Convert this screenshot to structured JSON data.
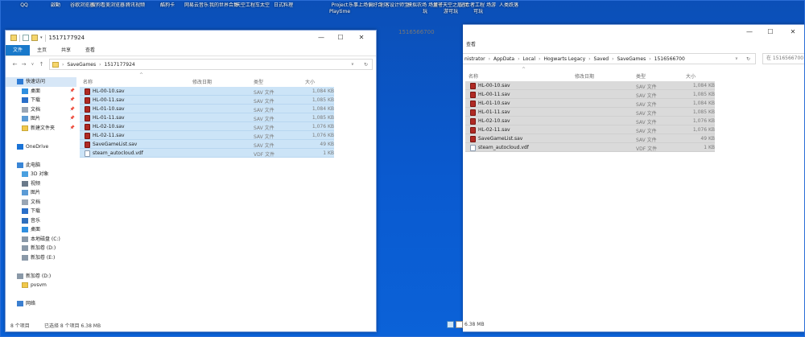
{
  "desktop": {
    "icons": [
      "QQ",
      "啟動",
      "谷歌浏览器",
      "搜狗看美浏览器",
      "腾讯视频",
      "酷狗卡",
      "网易云音乐",
      "我的世界合集",
      "天空工程车太空",
      "日式料理",
      "Project Playtime",
      "乐事上场偏好合",
      "创客设计师宝",
      "模拟农场 场游可玩",
      "量子天空之盾 场游可玩",
      "逃亡者工程 场游可玩",
      "人类跌落"
    ]
  },
  "window1": {
    "title": "1517177924",
    "ribbon_tabs": [
      "文件",
      "主页",
      "共享",
      "查看"
    ],
    "address": [
      "SaveGames",
      "1517177924"
    ],
    "nav_items": [
      {
        "label": "快速访问",
        "icon": "star-icon"
      },
      {
        "label": "桌面",
        "icon": "desktop-icon",
        "pinned": true
      },
      {
        "label": "下载",
        "icon": "download-icon",
        "pinned": true
      },
      {
        "label": "文档",
        "icon": "document-icon",
        "pinned": true
      },
      {
        "label": "图片",
        "icon": "picture-icon",
        "pinned": true
      },
      {
        "label": "新建文件夹",
        "icon": "folder-icon",
        "pinned": true
      },
      {
        "label": "",
        "icon": ""
      },
      {
        "label": "OneDrive",
        "icon": "cloud-icon"
      },
      {
        "label": "",
        "icon": ""
      },
      {
        "label": "此电脑",
        "icon": "computer-icon"
      },
      {
        "label": "3D 对象",
        "icon": "cube-icon"
      },
      {
        "label": "视频",
        "icon": "video-icon"
      },
      {
        "label": "图片",
        "icon": "picture-icon"
      },
      {
        "label": "文档",
        "icon": "document-icon"
      },
      {
        "label": "下载",
        "icon": "download-icon"
      },
      {
        "label": "音乐",
        "icon": "music-icon"
      },
      {
        "label": "桌面",
        "icon": "desktop-icon"
      },
      {
        "label": "本地磁盘 (C:)",
        "icon": "drive-icon"
      },
      {
        "label": "新加卷 (D:)",
        "icon": "drive-icon"
      },
      {
        "label": "新加卷 (E:)",
        "icon": "drive-icon"
      },
      {
        "label": "",
        "icon": ""
      },
      {
        "label": "新加卷 (D:)",
        "icon": "drive-icon"
      },
      {
        "label": "pvsvm",
        "icon": "folder-icon"
      },
      {
        "label": "",
        "icon": ""
      },
      {
        "label": "网络",
        "icon": "network-icon"
      }
    ],
    "columns": [
      "名称",
      "修改日期",
      "类型",
      "大小"
    ],
    "files": [
      {
        "name": "HL-00-10.sav",
        "type": "SAV 文件",
        "size": "1,084 KB",
        "icon": "sav"
      },
      {
        "name": "HL-00-11.sav",
        "type": "SAV 文件",
        "size": "1,085 KB",
        "icon": "sav"
      },
      {
        "name": "HL-01-10.sav",
        "type": "SAV 文件",
        "size": "1,084 KB",
        "icon": "sav"
      },
      {
        "name": "HL-01-11.sav",
        "type": "SAV 文件",
        "size": "1,085 KB",
        "icon": "sav"
      },
      {
        "name": "HL-02-10.sav",
        "type": "SAV 文件",
        "size": "1,076 KB",
        "icon": "sav"
      },
      {
        "name": "HL-02-11.sav",
        "type": "SAV 文件",
        "size": "1,076 KB",
        "icon": "sav"
      },
      {
        "name": "SaveGameList.sav",
        "type": "SAV 文件",
        "size": "49 KB",
        "icon": "sav"
      },
      {
        "name": "steam_autocloud.vdf",
        "type": "VDF 文件",
        "size": "1 KB",
        "icon": "vdf"
      }
    ],
    "status": {
      "count": "8 个项目",
      "selected": "已选择 8 个项目  6.38 MB"
    }
  },
  "window2": {
    "title": "1516566700",
    "ribbon_tabs": [
      "查看"
    ],
    "address": [
      "nistrator",
      "AppData",
      "Local",
      "Hogwarts Legacy",
      "Saved",
      "SaveGames",
      "1516566700"
    ],
    "search_placeholder": "在 1516566700",
    "columns": [
      "名称",
      "修改日期",
      "类型",
      "大小"
    ],
    "files": [
      {
        "name": "HL-00-10.sav",
        "type": "SAV 文件",
        "size": "1,084 KB",
        "icon": "sav"
      },
      {
        "name": "HL-00-11.sav",
        "type": "SAV 文件",
        "size": "1,085 KB",
        "icon": "sav"
      },
      {
        "name": "HL-01-10.sav",
        "type": "SAV 文件",
        "size": "1,084 KB",
        "icon": "sav"
      },
      {
        "name": "HL-01-11.sav",
        "type": "SAV 文件",
        "size": "1,085 KB",
        "icon": "sav"
      },
      {
        "name": "HL-02-10.sav",
        "type": "SAV 文件",
        "size": "1,076 KB",
        "icon": "sav"
      },
      {
        "name": "HL-02-11.sav",
        "type": "SAV 文件",
        "size": "1,076 KB",
        "icon": "sav"
      },
      {
        "name": "SaveGameList.sav",
        "type": "SAV 文件",
        "size": "49 KB",
        "icon": "sav"
      },
      {
        "name": "steam_autocloud.vdf",
        "type": "VDF 文件",
        "size": "1 KB",
        "icon": "vdf"
      }
    ],
    "status": {
      "size": "6.38 MB"
    }
  }
}
